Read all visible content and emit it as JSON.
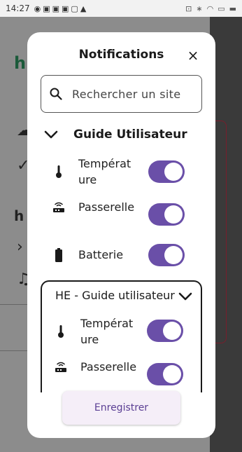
{
  "status_bar": {
    "time": "14:27"
  },
  "modal": {
    "title": "Notifications",
    "close": "×",
    "search": {
      "placeholder": "Rechercher un site",
      "value": ""
    },
    "group": {
      "title": "Guide Utilisateur",
      "expanded": true,
      "items": [
        {
          "label": "Température",
          "icon": "thermometer-icon",
          "enabled": true
        },
        {
          "label": "Passerelle",
          "icon": "router-icon",
          "enabled": true
        },
        {
          "label": "Batterie",
          "icon": "battery-icon",
          "enabled": true
        }
      ]
    },
    "subgroup": {
      "title": "HE - Guide utilisateur",
      "items": [
        {
          "label": "Température",
          "icon": "thermometer-icon",
          "enabled": true
        },
        {
          "label": "Passerelle",
          "icon": "router-icon",
          "enabled": true
        }
      ]
    },
    "save_label": "Enregistrer",
    "accent_color": "#6a4fa8"
  }
}
